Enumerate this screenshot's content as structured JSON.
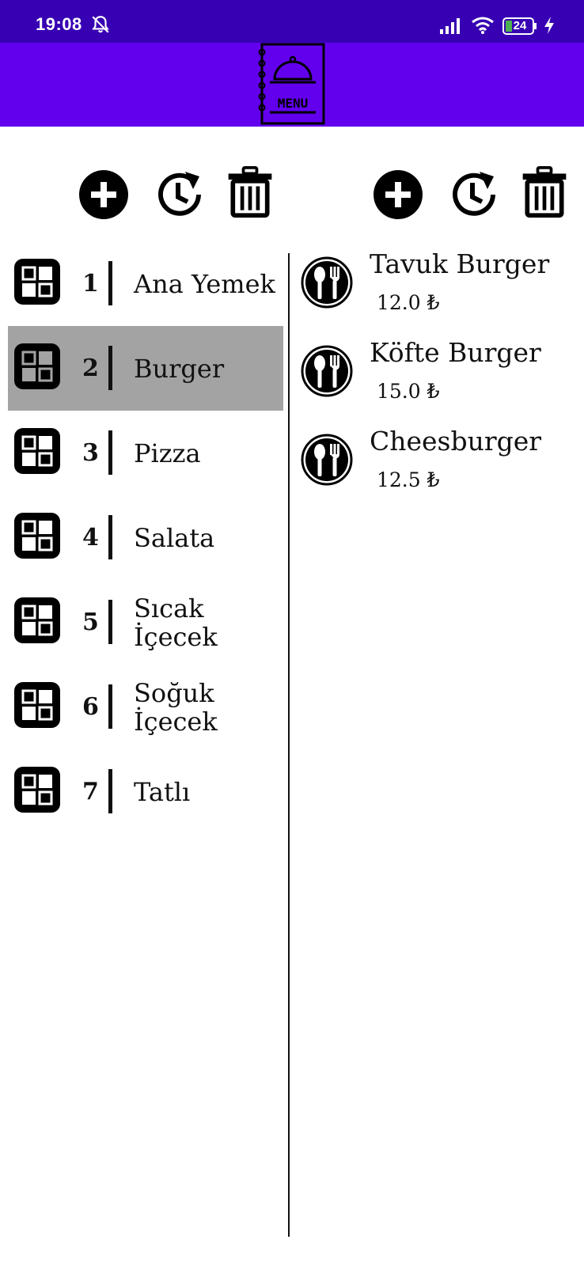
{
  "status_bar": {
    "time": "19:08",
    "battery": "24",
    "icons": [
      "bell-off-icon",
      "signal-icon",
      "wifi-icon",
      "battery-icon",
      "charging-bolt-icon"
    ]
  },
  "app_bar": {
    "logo_text": "MENU",
    "background": "#6200ee",
    "status_background": "#3700b3"
  },
  "category_toolbar": {
    "icons": [
      "add-circle-icon",
      "history-icon",
      "trash-icon"
    ]
  },
  "product_toolbar": {
    "icons": [
      "add-circle-icon",
      "history-icon",
      "trash-icon"
    ]
  },
  "categories": [
    {
      "num": "1",
      "name": "Ana Yemek",
      "selected": false
    },
    {
      "num": "2",
      "name": "Burger",
      "selected": true
    },
    {
      "num": "3",
      "name": "Pizza",
      "selected": false
    },
    {
      "num": "4",
      "name": "Salata",
      "selected": false
    },
    {
      "num": "5",
      "name": "Sıcak İçecek",
      "selected": false
    },
    {
      "num": "6",
      "name": "Soğuk İçecek",
      "selected": false
    },
    {
      "num": "7",
      "name": "Tatlı",
      "selected": false
    }
  ],
  "products": [
    {
      "name": "Tavuk Burger",
      "price": "12.0 ₺"
    },
    {
      "name": "Köfte Burger",
      "price": "15.0 ₺"
    },
    {
      "name": "Cheesburger",
      "price": "12.5 ₺"
    }
  ],
  "colors": {
    "selected_row": "#a3a3a3"
  }
}
